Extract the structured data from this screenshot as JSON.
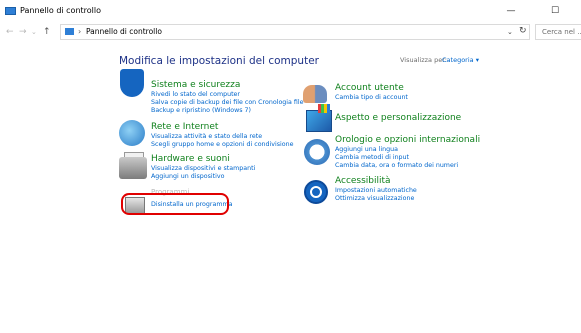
{
  "window": {
    "title": "Pannello di controllo",
    "minimize_glyph": "—",
    "maximize_glyph": "☐"
  },
  "nav": {
    "back": "←",
    "forward": "→",
    "history": "⌄",
    "up": "↑",
    "separator": "›",
    "breadcrumb": "Pannello di controllo",
    "dropdown": "⌄",
    "refresh": "↻",
    "search_text": "Cerca nel ..."
  },
  "header": {
    "heading": "Modifica le impostazioni del computer",
    "view_by_label": "Visualizza per:",
    "view_by_value": "Categoria ▾"
  },
  "categories_left": [
    {
      "title": "Sistema e sicurezza",
      "icon": "shield-icon",
      "links": [
        "Rivedi lo stato del computer",
        "Salva copie di backup dei file con Cronologia file",
        "Backup e ripristino (Windows 7)"
      ]
    },
    {
      "title": "Rete e Internet",
      "icon": "globe-network-icon",
      "links": [
        "Visualizza attività e stato della rete",
        "Scegli gruppo home e opzioni di condivisione"
      ]
    },
    {
      "title": "Hardware e suoni",
      "icon": "printer-icon",
      "links": [
        "Visualizza dispositivi e stampanti",
        "Aggiungi un dispositivo"
      ]
    },
    {
      "title": "Programmi",
      "icon": "programs-icon",
      "links": [
        "Disinstalla un programma"
      ]
    }
  ],
  "categories_right": [
    {
      "title": "Account utente",
      "icon": "users-icon",
      "links": [
        "Cambia tipo di account"
      ]
    },
    {
      "title": "Aspetto e personalizzazione",
      "icon": "appearance-icon",
      "links": []
    },
    {
      "title": "Orologio e opzioni internazionali",
      "icon": "clock-globe-icon",
      "links": [
        "Aggiungi una lingua",
        "Cambia metodi di input",
        "Cambia data, ora o formato dei numeri"
      ]
    },
    {
      "title": "Accessibilità",
      "icon": "accessibility-icon",
      "links": [
        "Impostazioni automatiche",
        "Ottimizza visualizzazione"
      ]
    }
  ],
  "colors": {
    "heading": "#1e3287",
    "category_title": "#10811d",
    "link": "#0066cc",
    "highlight": "#e00000"
  }
}
